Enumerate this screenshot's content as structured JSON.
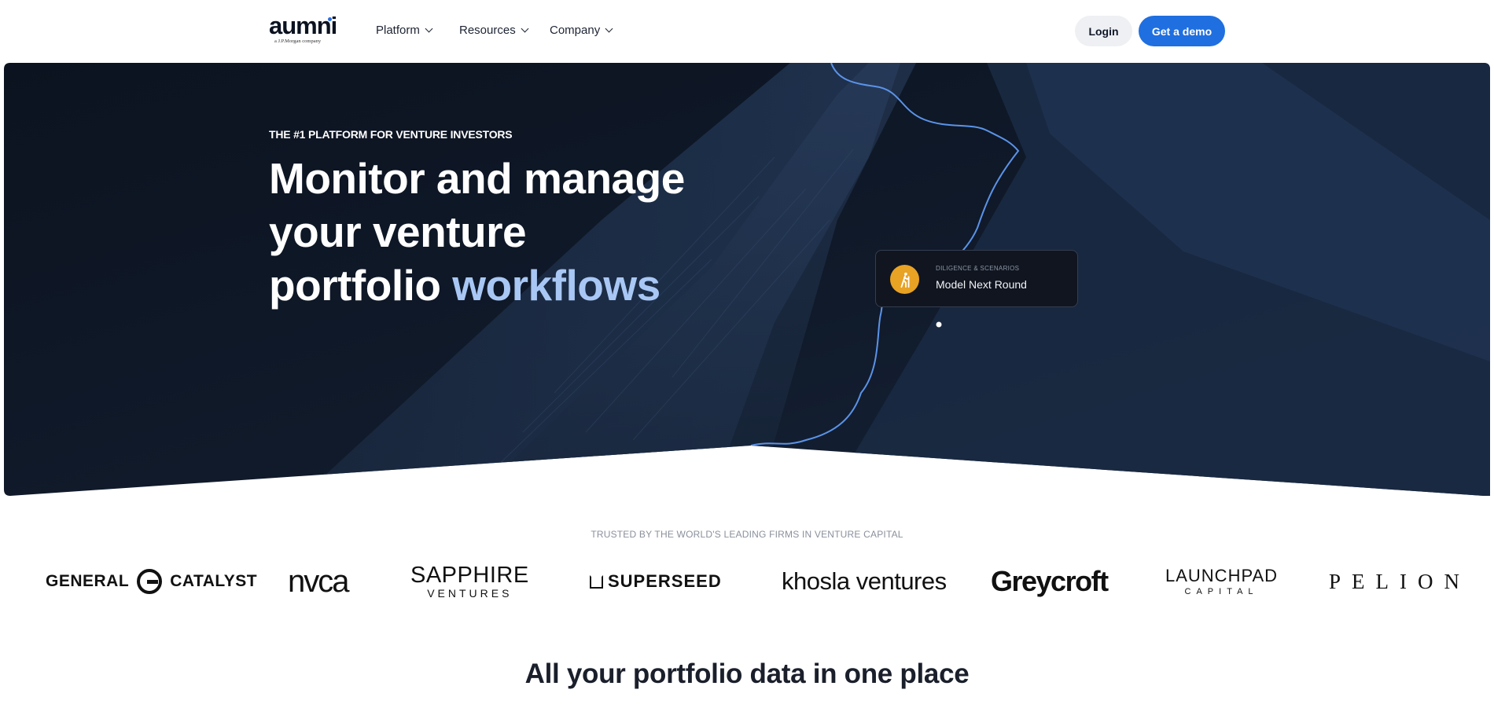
{
  "nav": {
    "logo": {
      "word": "aumni",
      "tagline": "a J.P.Morgan company"
    },
    "items": [
      {
        "label": "Platform"
      },
      {
        "label": "Resources"
      },
      {
        "label": "Company"
      }
    ],
    "login_label": "Login",
    "demo_label": "Get a demo"
  },
  "hero": {
    "eyebrow": "THE #1 PLATFORM FOR VENTURE INVESTORS",
    "headline_line1": "Monitor and manage",
    "headline_line2": "your venture",
    "headline_line3_plain": "portfolio",
    "headline_line3_accent": "workflows",
    "card": {
      "kicker": "DILIGENCE & SCENARIOS",
      "title": "Model Next Round",
      "icon": "hiker-icon"
    }
  },
  "trust": {
    "caption": "TRUSTED BY THE WORLD'S LEADING FIRMS IN VENTURE CAPITAL",
    "logos": [
      {
        "name": "GENERAL CATALYST",
        "left": "GENERAL",
        "right": "CATALYST"
      },
      {
        "name": "nvca"
      },
      {
        "name": "SAPPHIRE VENTURES",
        "line1": "SAPPHIRE",
        "line2": "VENTURES"
      },
      {
        "name": "SUPERSEED"
      },
      {
        "name": "khosla ventures"
      },
      {
        "name": "Greycroft"
      },
      {
        "name": "LAUNCHPAD CAPITAL",
        "line1": "LAUNCHPAD",
        "line2": "CAPITAL"
      },
      {
        "name": "PELION"
      }
    ]
  },
  "section": {
    "title": "All your portfolio data in one place"
  },
  "colors": {
    "brand_blue": "#1f6fe0",
    "hero_bg": "#0f1826",
    "accent_text": "#a9c7f4",
    "card_icon_bg": "#e8a224",
    "trail": "#5b93e8"
  }
}
